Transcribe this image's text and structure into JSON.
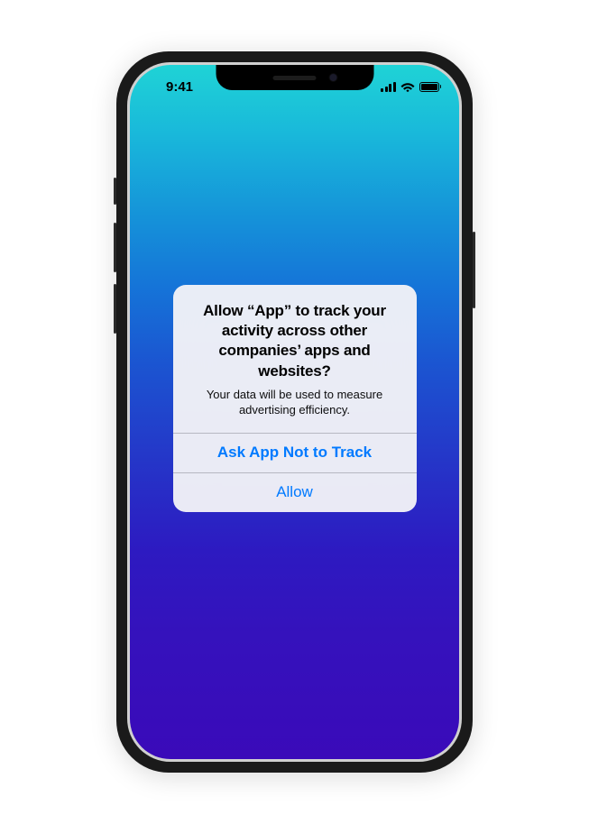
{
  "status_bar": {
    "time": "9:41"
  },
  "alert": {
    "title": "Allow “App” to track your activity across other companies’ apps and websites?",
    "message": "Your data will be used to measure advertising efficiency.",
    "buttons": {
      "deny": "Ask App Not to Track",
      "allow": "Allow"
    }
  }
}
